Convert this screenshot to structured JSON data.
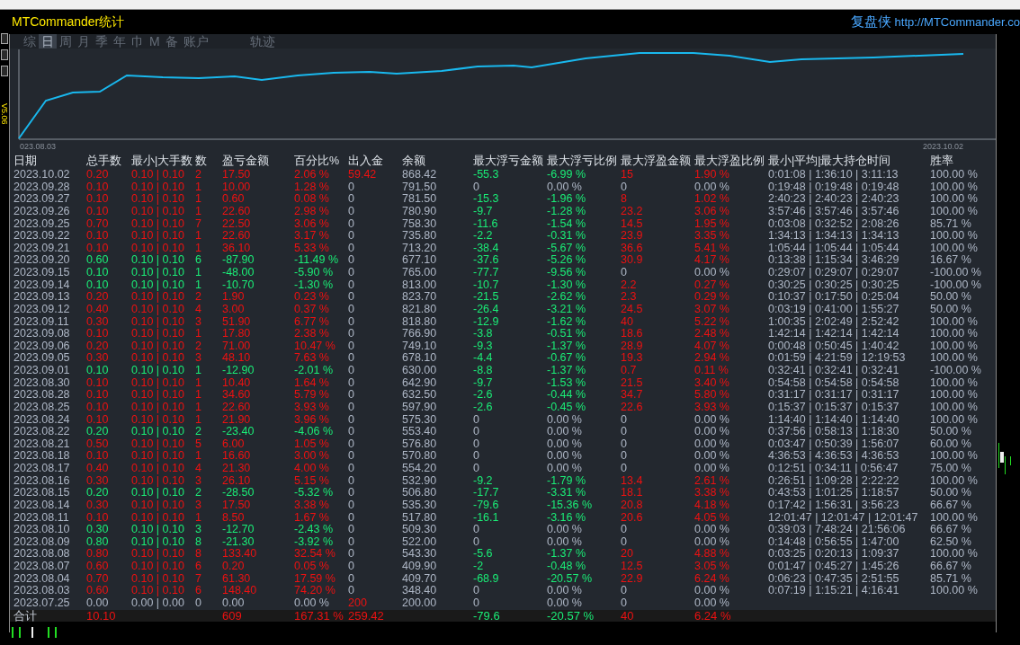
{
  "window": {
    "title": "MTCommander统计",
    "brand": "复盘侠",
    "url": "http://MTCommander.co",
    "version": "V5.06"
  },
  "tabs": [
    {
      "label": "综",
      "selected": false
    },
    {
      "label": "日",
      "selected": true
    },
    {
      "label": "周",
      "selected": false
    },
    {
      "label": "月",
      "selected": false
    },
    {
      "label": "季",
      "selected": false
    },
    {
      "label": "年",
      "selected": false
    },
    {
      "label": "巾",
      "selected": false
    },
    {
      "label": "M",
      "selected": false
    },
    {
      "label": "备",
      "selected": false
    },
    {
      "label": "账户",
      "selected": false
    },
    {
      "label": "轨迹",
      "selected": false
    }
  ],
  "chart": {
    "start_label": "023.08.03",
    "end_label": "2023.10.02"
  },
  "table": {
    "columns": [
      "日期",
      "总手数",
      "最小|大手数",
      "数",
      "盈亏金额",
      "百分比%",
      "出入金",
      "余额",
      "最大浮亏金额",
      "最大浮亏比例",
      "最大浮盈金额",
      "最大浮盈比例",
      "最小|平均|最大持仓时间",
      "胜率"
    ],
    "rows": [
      {
        "kind": "profit",
        "deposit": true,
        "float_loss": true,
        "float_profit": true,
        "cells": [
          "2023.10.02",
          "0.20",
          "0.10 | 0.10",
          "2",
          "17.50",
          "2.06 %",
          "59.42",
          "868.42",
          "-55.3",
          "-6.99 %",
          "15",
          "1.90 %",
          "0:01:08 | 1:36:10 | 3:11:13",
          "100.00 %"
        ]
      },
      {
        "kind": "profit",
        "deposit": false,
        "float_loss": false,
        "float_profit": false,
        "cells": [
          "2023.09.28",
          "0.10",
          "0.10 | 0.10",
          "1",
          "10.00",
          "1.28 %",
          "0",
          "791.50",
          "0",
          "0.00 %",
          "0",
          "0.00 %",
          "0:19:48 | 0:19:48 | 0:19:48",
          "100.00 %"
        ]
      },
      {
        "kind": "profit",
        "deposit": false,
        "float_loss": true,
        "float_profit": true,
        "cells": [
          "2023.09.27",
          "0.10",
          "0.10 | 0.10",
          "1",
          "0.60",
          "0.08 %",
          "0",
          "781.50",
          "-15.3",
          "-1.96 %",
          "8",
          "1.02 %",
          "2:40:23 | 2:40:23 | 2:40:23",
          "100.00 %"
        ]
      },
      {
        "kind": "profit",
        "deposit": false,
        "float_loss": true,
        "float_profit": true,
        "cells": [
          "2023.09.26",
          "0.10",
          "0.10 | 0.10",
          "1",
          "22.60",
          "2.98 %",
          "0",
          "780.90",
          "-9.7",
          "-1.28 %",
          "23.2",
          "3.06 %",
          "3:57:46 | 3:57:46 | 3:57:46",
          "100.00 %"
        ]
      },
      {
        "kind": "profit",
        "deposit": false,
        "float_loss": true,
        "float_profit": true,
        "cells": [
          "2023.09.25",
          "0.70",
          "0.10 | 0.10",
          "7",
          "22.50",
          "3.06 %",
          "0",
          "758.30",
          "-11.6",
          "-1.54 %",
          "14.5",
          "1.95 %",
          "0:03:08 | 0:32:52 | 2:08:26",
          "85.71 %"
        ]
      },
      {
        "kind": "profit",
        "deposit": false,
        "float_loss": true,
        "float_profit": true,
        "cells": [
          "2023.09.22",
          "0.10",
          "0.10 | 0.10",
          "1",
          "22.60",
          "3.17 %",
          "0",
          "735.80",
          "-2.2",
          "-0.31 %",
          "23.9",
          "3.35 %",
          "1:34:13 | 1:34:13 | 1:34:13",
          "100.00 %"
        ]
      },
      {
        "kind": "profit",
        "deposit": false,
        "float_loss": true,
        "float_profit": true,
        "cells": [
          "2023.09.21",
          "0.10",
          "0.10 | 0.10",
          "1",
          "36.10",
          "5.33 %",
          "0",
          "713.20",
          "-38.4",
          "-5.67 %",
          "36.6",
          "5.41 %",
          "1:05:44 | 1:05:44 | 1:05:44",
          "100.00 %"
        ]
      },
      {
        "kind": "loss",
        "deposit": false,
        "float_loss": true,
        "float_profit": true,
        "cells": [
          "2023.09.20",
          "0.60",
          "0.10 | 0.10",
          "6",
          "-87.90",
          "-11.49 %",
          "0",
          "677.10",
          "-37.6",
          "-5.26 %",
          "30.9",
          "4.17 %",
          "0:13:38 | 1:15:34 | 3:46:29",
          "16.67 %"
        ]
      },
      {
        "kind": "loss",
        "deposit": false,
        "float_loss": true,
        "float_profit": false,
        "cells": [
          "2023.09.15",
          "0.10",
          "0.10 | 0.10",
          "1",
          "-48.00",
          "-5.90 %",
          "0",
          "765.00",
          "-77.7",
          "-9.56 %",
          "0",
          "0.00 %",
          "0:29:07 | 0:29:07 | 0:29:07",
          "-100.00 %"
        ]
      },
      {
        "kind": "loss",
        "deposit": false,
        "float_loss": true,
        "float_profit": true,
        "cells": [
          "2023.09.14",
          "0.10",
          "0.10 | 0.10",
          "1",
          "-10.70",
          "-1.30 %",
          "0",
          "813.00",
          "-10.7",
          "-1.30 %",
          "2.2",
          "0.27 %",
          "0:30:25 | 0:30:25 | 0:30:25",
          "-100.00 %"
        ]
      },
      {
        "kind": "profit",
        "deposit": false,
        "float_loss": true,
        "float_profit": true,
        "cells": [
          "2023.09.13",
          "0.20",
          "0.10 | 0.10",
          "2",
          "1.90",
          "0.23 %",
          "0",
          "823.70",
          "-21.5",
          "-2.62 %",
          "2.3",
          "0.29 %",
          "0:10:37 | 0:17:50 | 0:25:04",
          "50.00 %"
        ]
      },
      {
        "kind": "profit",
        "deposit": false,
        "float_loss": true,
        "float_profit": true,
        "cells": [
          "2023.09.12",
          "0.40",
          "0.10 | 0.10",
          "4",
          "3.00",
          "0.37 %",
          "0",
          "821.80",
          "-26.4",
          "-3.21 %",
          "24.5",
          "3.07 %",
          "0:03:19 | 0:41:00 | 1:55:27",
          "50.00 %"
        ]
      },
      {
        "kind": "profit",
        "deposit": false,
        "float_loss": true,
        "float_profit": true,
        "cells": [
          "2023.09.11",
          "0.30",
          "0.10 | 0.10",
          "3",
          "51.90",
          "6.77 %",
          "0",
          "818.80",
          "-12.9",
          "-1.62 %",
          "40",
          "5.22 %",
          "1:00:35 | 2:02:49 | 2:52:42",
          "100.00 %"
        ]
      },
      {
        "kind": "profit",
        "deposit": false,
        "float_loss": true,
        "float_profit": true,
        "cells": [
          "2023.09.08",
          "0.10",
          "0.10 | 0.10",
          "1",
          "17.80",
          "2.38 %",
          "0",
          "766.90",
          "-3.8",
          "-0.51 %",
          "18.6",
          "2.48 %",
          "1:42:14 | 1:42:14 | 1:42:14",
          "100.00 %"
        ]
      },
      {
        "kind": "profit",
        "deposit": false,
        "float_loss": true,
        "float_profit": true,
        "cells": [
          "2023.09.06",
          "0.20",
          "0.10 | 0.10",
          "2",
          "71.00",
          "10.47 %",
          "0",
          "749.10",
          "-9.3",
          "-1.37 %",
          "28.9",
          "4.07 %",
          "0:00:48 | 0:50:45 | 1:40:42",
          "100.00 %"
        ]
      },
      {
        "kind": "profit",
        "deposit": false,
        "float_loss": true,
        "float_profit": true,
        "cells": [
          "2023.09.05",
          "0.30",
          "0.10 | 0.10",
          "3",
          "48.10",
          "7.63 %",
          "0",
          "678.10",
          "-4.4",
          "-0.67 %",
          "19.3",
          "2.94 %",
          "0:01:59 | 4:21:59 | 12:19:53",
          "100.00 %"
        ]
      },
      {
        "kind": "loss",
        "deposit": false,
        "float_loss": true,
        "float_profit": true,
        "cells": [
          "2023.09.01",
          "0.10",
          "0.10 | 0.10",
          "1",
          "-12.90",
          "-2.01 %",
          "0",
          "630.00",
          "-8.8",
          "-1.37 %",
          "0.7",
          "0.11 %",
          "0:32:41 | 0:32:41 | 0:32:41",
          "-100.00 %"
        ]
      },
      {
        "kind": "profit",
        "deposit": false,
        "float_loss": true,
        "float_profit": true,
        "cells": [
          "2023.08.30",
          "0.10",
          "0.10 | 0.10",
          "1",
          "10.40",
          "1.64 %",
          "0",
          "642.90",
          "-9.7",
          "-1.53 %",
          "21.5",
          "3.40 %",
          "0:54:58 | 0:54:58 | 0:54:58",
          "100.00 %"
        ]
      },
      {
        "kind": "profit",
        "deposit": false,
        "float_loss": true,
        "float_profit": true,
        "cells": [
          "2023.08.28",
          "0.10",
          "0.10 | 0.10",
          "1",
          "34.60",
          "5.79 %",
          "0",
          "632.50",
          "-2.6",
          "-0.44 %",
          "34.7",
          "5.80 %",
          "0:31:17 | 0:31:17 | 0:31:17",
          "100.00 %"
        ]
      },
      {
        "kind": "profit",
        "deposit": false,
        "float_loss": true,
        "float_profit": true,
        "cells": [
          "2023.08.25",
          "0.10",
          "0.10 | 0.10",
          "1",
          "22.60",
          "3.93 %",
          "0",
          "597.90",
          "-2.6",
          "-0.45 %",
          "22.6",
          "3.93 %",
          "0:15:37 | 0:15:37 | 0:15:37",
          "100.00 %"
        ]
      },
      {
        "kind": "profit",
        "deposit": false,
        "float_loss": false,
        "float_profit": false,
        "cells": [
          "2023.08.24",
          "0.10",
          "0.10 | 0.10",
          "1",
          "21.90",
          "3.96 %",
          "0",
          "575.30",
          "0",
          "0.00 %",
          "0",
          "0.00 %",
          "1:14:40 | 1:14:40 | 1:14:40",
          "100.00 %"
        ]
      },
      {
        "kind": "loss",
        "deposit": false,
        "float_loss": false,
        "float_profit": false,
        "cells": [
          "2023.08.22",
          "0.20",
          "0.10 | 0.10",
          "2",
          "-23.40",
          "-4.06 %",
          "0",
          "553.40",
          "0",
          "0.00 %",
          "0",
          "0.00 %",
          "0:37:56 | 0:58:13 | 1:18:30",
          "50.00 %"
        ]
      },
      {
        "kind": "profit",
        "deposit": false,
        "float_loss": false,
        "float_profit": false,
        "cells": [
          "2023.08.21",
          "0.50",
          "0.10 | 0.10",
          "5",
          "6.00",
          "1.05 %",
          "0",
          "576.80",
          "0",
          "0.00 %",
          "0",
          "0.00 %",
          "0:03:47 | 0:50:39 | 1:56:07",
          "60.00 %"
        ]
      },
      {
        "kind": "profit",
        "deposit": false,
        "float_loss": false,
        "float_profit": false,
        "cells": [
          "2023.08.18",
          "0.10",
          "0.10 | 0.10",
          "1",
          "16.60",
          "3.00 %",
          "0",
          "570.80",
          "0",
          "0.00 %",
          "0",
          "0.00 %",
          "4:36:53 | 4:36:53 | 4:36:53",
          "100.00 %"
        ]
      },
      {
        "kind": "profit",
        "deposit": false,
        "float_loss": false,
        "float_profit": false,
        "cells": [
          "2023.08.17",
          "0.40",
          "0.10 | 0.10",
          "4",
          "21.30",
          "4.00 %",
          "0",
          "554.20",
          "0",
          "0.00 %",
          "0",
          "0.00 %",
          "0:12:51 | 0:34:11 | 0:56:47",
          "75.00 %"
        ]
      },
      {
        "kind": "profit",
        "deposit": false,
        "float_loss": true,
        "float_profit": true,
        "cells": [
          "2023.08.16",
          "0.30",
          "0.10 | 0.10",
          "3",
          "26.10",
          "5.15 %",
          "0",
          "532.90",
          "-9.2",
          "-1.79 %",
          "13.4",
          "2.61 %",
          "0:26:51 | 1:09:28 | 2:22:22",
          "100.00 %"
        ]
      },
      {
        "kind": "loss",
        "deposit": false,
        "float_loss": true,
        "float_profit": true,
        "cells": [
          "2023.08.15",
          "0.20",
          "0.10 | 0.10",
          "2",
          "-28.50",
          "-5.32 %",
          "0",
          "506.80",
          "-17.7",
          "-3.31 %",
          "18.1",
          "3.38 %",
          "0:43:53 | 1:01:25 | 1:18:57",
          "50.00 %"
        ]
      },
      {
        "kind": "profit",
        "deposit": false,
        "float_loss": true,
        "float_profit": true,
        "cells": [
          "2023.08.14",
          "0.30",
          "0.10 | 0.10",
          "3",
          "17.50",
          "3.38 %",
          "0",
          "535.30",
          "-79.6",
          "-15.36 %",
          "20.8",
          "4.18 %",
          "0:17:42 | 1:56:31 | 3:56:23",
          "66.67 %"
        ]
      },
      {
        "kind": "profit",
        "deposit": false,
        "float_loss": true,
        "float_profit": true,
        "cells": [
          "2023.08.11",
          "0.10",
          "0.10 | 0.10",
          "1",
          "8.50",
          "1.67 %",
          "0",
          "517.80",
          "-16.1",
          "-3.16 %",
          "20.6",
          "4.05 %",
          "12:01:47 | 12:01:47 | 12:01:47",
          "100.00 %"
        ]
      },
      {
        "kind": "loss",
        "deposit": false,
        "float_loss": false,
        "float_profit": false,
        "cells": [
          "2023.08.10",
          "0.30",
          "0.10 | 0.10",
          "3",
          "-12.70",
          "-2.43 %",
          "0",
          "509.30",
          "0",
          "0.00 %",
          "0",
          "0.00 %",
          "0:39:03 | 7:48:24 | 21:56:06",
          "66.67 %"
        ]
      },
      {
        "kind": "loss",
        "deposit": false,
        "float_loss": false,
        "float_profit": false,
        "cells": [
          "2023.08.09",
          "0.80",
          "0.10 | 0.10",
          "8",
          "-21.30",
          "-3.92 %",
          "0",
          "522.00",
          "0",
          "0.00 %",
          "0",
          "0.00 %",
          "0:14:48 | 0:56:55 | 1:47:00",
          "62.50 %"
        ]
      },
      {
        "kind": "profit",
        "deposit": false,
        "float_loss": true,
        "float_profit": true,
        "cells": [
          "2023.08.08",
          "0.80",
          "0.10 | 0.10",
          "8",
          "133.40",
          "32.54 %",
          "0",
          "543.30",
          "-5.6",
          "-1.37 %",
          "20",
          "4.88 %",
          "0:03:25 | 0:20:13 | 1:09:37",
          "100.00 %"
        ]
      },
      {
        "kind": "profit",
        "deposit": false,
        "float_loss": true,
        "float_profit": true,
        "cells": [
          "2023.08.07",
          "0.60",
          "0.10 | 0.10",
          "6",
          "0.20",
          "0.05 %",
          "0",
          "409.90",
          "-2",
          "-0.48 %",
          "12.5",
          "3.05 %",
          "0:01:47 | 0:45:27 | 1:45:26",
          "66.67 %"
        ]
      },
      {
        "kind": "profit",
        "deposit": false,
        "float_loss": true,
        "float_profit": true,
        "cells": [
          "2023.08.04",
          "0.70",
          "0.10 | 0.10",
          "7",
          "61.30",
          "17.59 %",
          "0",
          "409.70",
          "-68.9",
          "-20.57 %",
          "22.9",
          "6.24 %",
          "0:06:23 | 0:47:35 | 2:51:55",
          "85.71 %"
        ]
      },
      {
        "kind": "profit",
        "deposit": false,
        "float_loss": false,
        "float_profit": false,
        "cells": [
          "2023.08.03",
          "0.60",
          "0.10 | 0.10",
          "6",
          "148.40",
          "74.20 %",
          "0",
          "348.40",
          "0",
          "0.00 %",
          "0",
          "0.00 %",
          "0:07:19 | 1:15:21 | 4:16:41",
          "100.00 %"
        ]
      },
      {
        "kind": "flat",
        "deposit": true,
        "float_loss": false,
        "float_profit": false,
        "cells": [
          "2023.07.25",
          "0.00",
          "0.00 | 0.00",
          "0",
          "0.00",
          "0.00 %",
          "200",
          "200.00",
          "0",
          "0.00 %",
          "0",
          "0.00 %"
        ]
      }
    ],
    "total": {
      "label": "合计",
      "lots": "10.10",
      "pnl": "609",
      "pct": "167.31 %",
      "cash": "259.42",
      "float_loss": "-79.6",
      "float_loss_pct": "-20.57 %",
      "float_profit": "40",
      "float_profit_pct": "6.24 %"
    }
  }
}
